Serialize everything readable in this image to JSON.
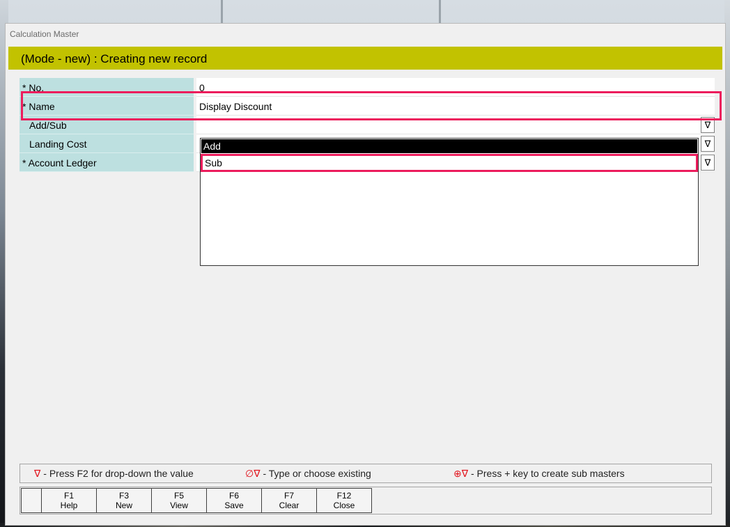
{
  "window": {
    "title": "Calculation Master"
  },
  "mode_bar": {
    "text": "(Mode - new) : Creating new record"
  },
  "form": {
    "rows": [
      {
        "label": "* No.",
        "value": "0"
      },
      {
        "label": "* Name",
        "value": "Display Discount"
      },
      {
        "label": "Add/Sub",
        "value": ""
      },
      {
        "label": "Landing Cost",
        "value": ""
      },
      {
        "label": "* Account Ledger",
        "value": ""
      }
    ],
    "dropdown_arrow": "∇"
  },
  "dropdown": {
    "options": [
      "Add",
      "Sub"
    ]
  },
  "legend": {
    "item1_symbol": "∇",
    "item1_text": "- Press F2 for drop-down the value",
    "item2_symbol": "∅∇",
    "item2_text": "- Type or choose existing",
    "item3_symbol": "⊕∇",
    "item3_text": "- Press + key to create sub masters"
  },
  "fkeys": [
    {
      "key": "F1",
      "label": "Help"
    },
    {
      "key": "F3",
      "label": "New"
    },
    {
      "key": "F5",
      "label": "View"
    },
    {
      "key": "F6",
      "label": "Save"
    },
    {
      "key": "F7",
      "label": "Clear"
    },
    {
      "key": "F12",
      "label": "Close"
    }
  ],
  "colors": {
    "mode_bar": "#c2c200",
    "label_bg": "#bde0e0",
    "highlight": "#ec1c5c",
    "legend_symbol": "#e2141d"
  }
}
